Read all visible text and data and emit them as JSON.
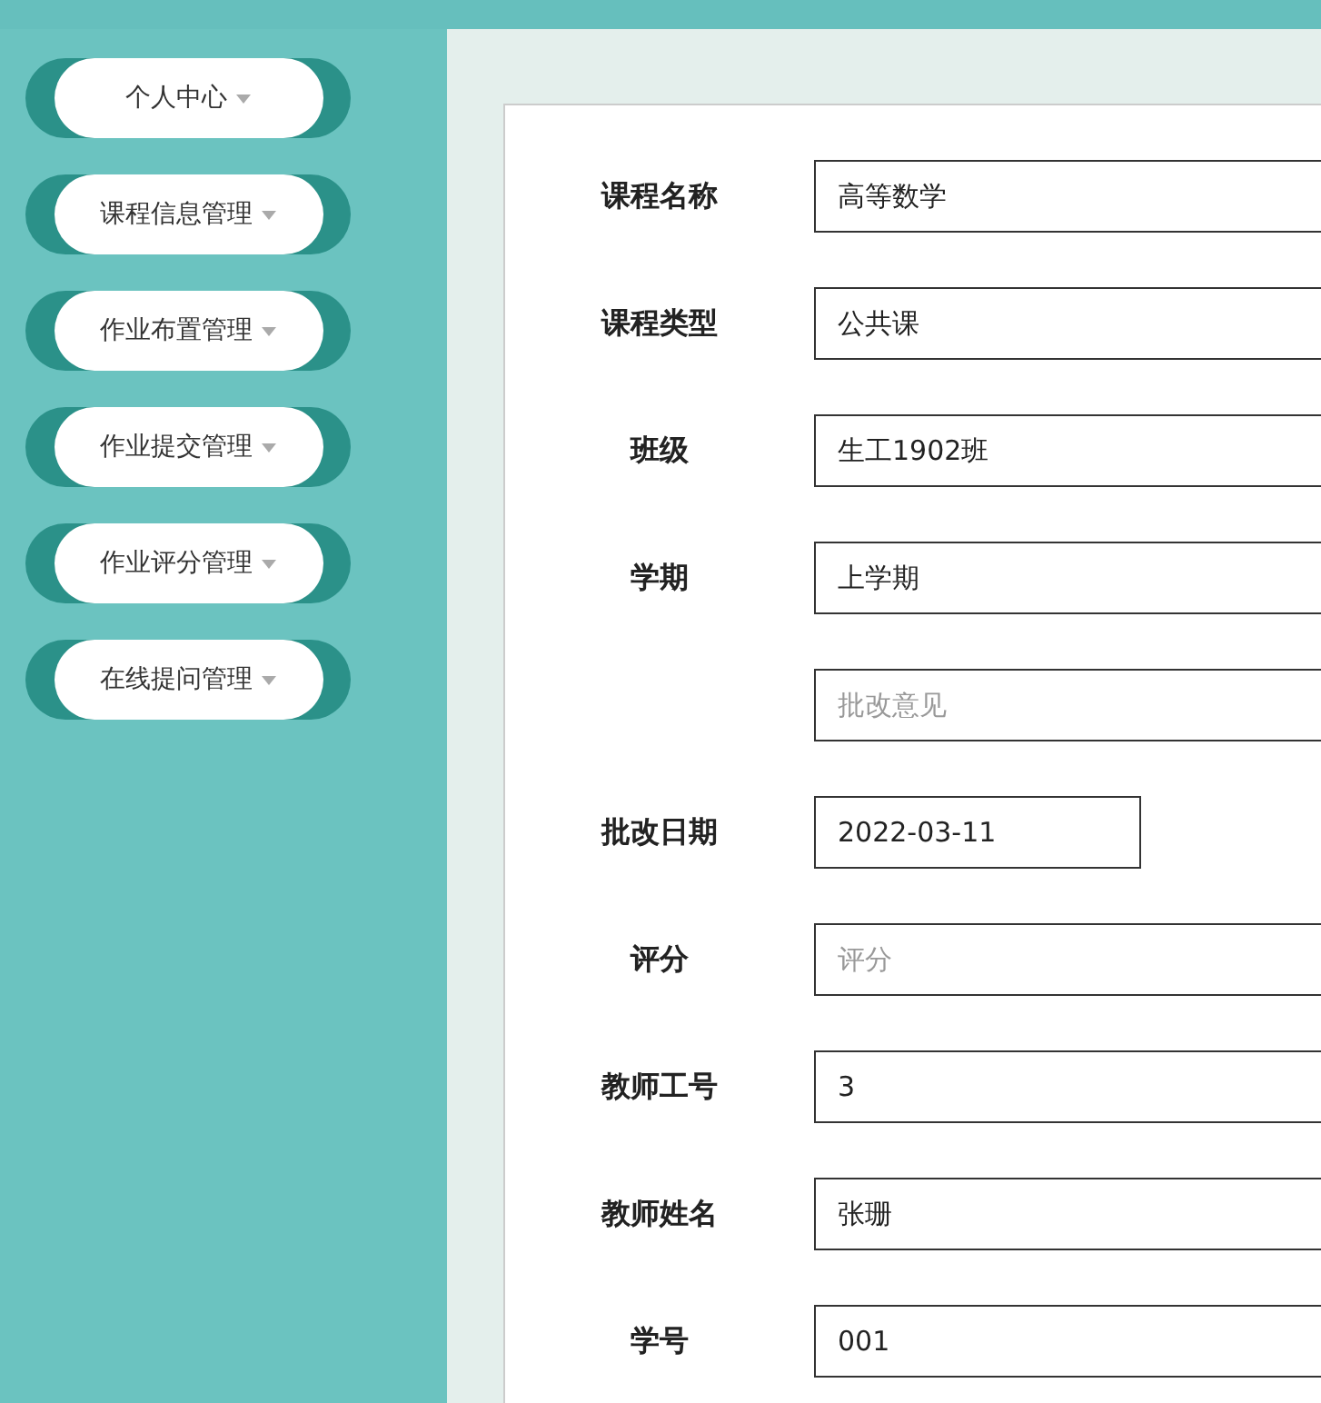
{
  "sidebar": {
    "items": [
      {
        "label": "个人中心"
      },
      {
        "label": "课程信息管理"
      },
      {
        "label": "作业布置管理"
      },
      {
        "label": "作业提交管理"
      },
      {
        "label": "作业评分管理"
      },
      {
        "label": "在线提问管理"
      }
    ]
  },
  "form": {
    "fields": [
      {
        "label": "课程名称",
        "value": "高等数学",
        "kind": "text"
      },
      {
        "label": "课程类型",
        "value": "公共课",
        "kind": "text"
      },
      {
        "label": "班级",
        "value": "生工1902班",
        "kind": "text"
      },
      {
        "label": "学期",
        "value": "上学期",
        "kind": "text"
      },
      {
        "placeholder": "批改意见",
        "kind": "text"
      },
      {
        "label": "批改日期",
        "value": "2022-03-11",
        "kind": "date"
      },
      {
        "label": "评分",
        "placeholder": "评分",
        "kind": "text"
      },
      {
        "label": "教师工号",
        "value": "3",
        "kind": "text"
      },
      {
        "label": "教师姓名",
        "value": "张珊",
        "kind": "text"
      },
      {
        "label": "学号",
        "value": "001",
        "kind": "text"
      }
    ]
  }
}
